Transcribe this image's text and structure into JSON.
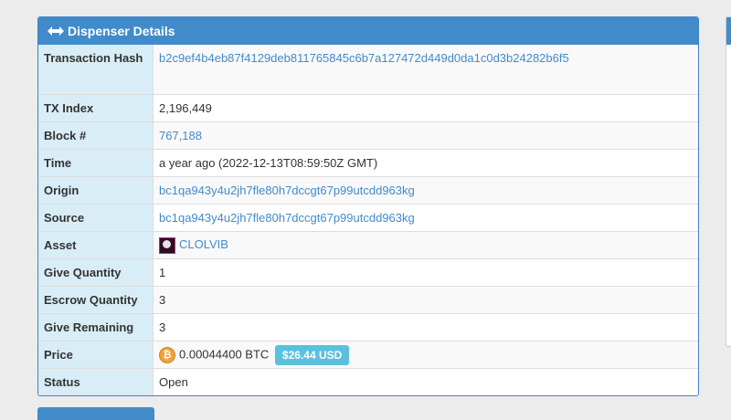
{
  "panel": {
    "title": "Dispenser Details",
    "header_icon": "arrows-h-icon"
  },
  "rows": {
    "tx_hash": {
      "label": "Transaction Hash",
      "value": "b2c9ef4b4eb87f4129deb811765845c6b7a127472d449d0da1c0d3b24282b6f5"
    },
    "tx_index": {
      "label": "TX Index",
      "value": "2,196,449"
    },
    "block": {
      "label": "Block #",
      "value": "767,188"
    },
    "time": {
      "label": "Time",
      "value": "a year ago (2022-12-13T08:59:50Z GMT)"
    },
    "origin": {
      "label": "Origin",
      "value": "bc1qa943y4u2jh7fle80h7dccgt67p99utcdd963kg"
    },
    "source": {
      "label": "Source",
      "value": "bc1qa943y4u2jh7fle80h7dccgt67p99utcdd963kg"
    },
    "asset": {
      "label": "Asset",
      "value": "CLOLVIB"
    },
    "give_quantity": {
      "label": "Give Quantity",
      "value": "1"
    },
    "escrow_quantity": {
      "label": "Escrow Quantity",
      "value": "3"
    },
    "give_remaining": {
      "label": "Give Remaining",
      "value": "3"
    },
    "price": {
      "label": "Price",
      "value": "0.00044400 BTC",
      "usd": "$26.44 USD",
      "btc_symbol": "₿"
    },
    "status": {
      "label": "Status",
      "value": "Open"
    }
  },
  "colors": {
    "header": "#428bca",
    "label_bg": "#d9edf7",
    "link": "#428bca",
    "badge": "#5bc0de",
    "btc": "#f2a23a"
  }
}
